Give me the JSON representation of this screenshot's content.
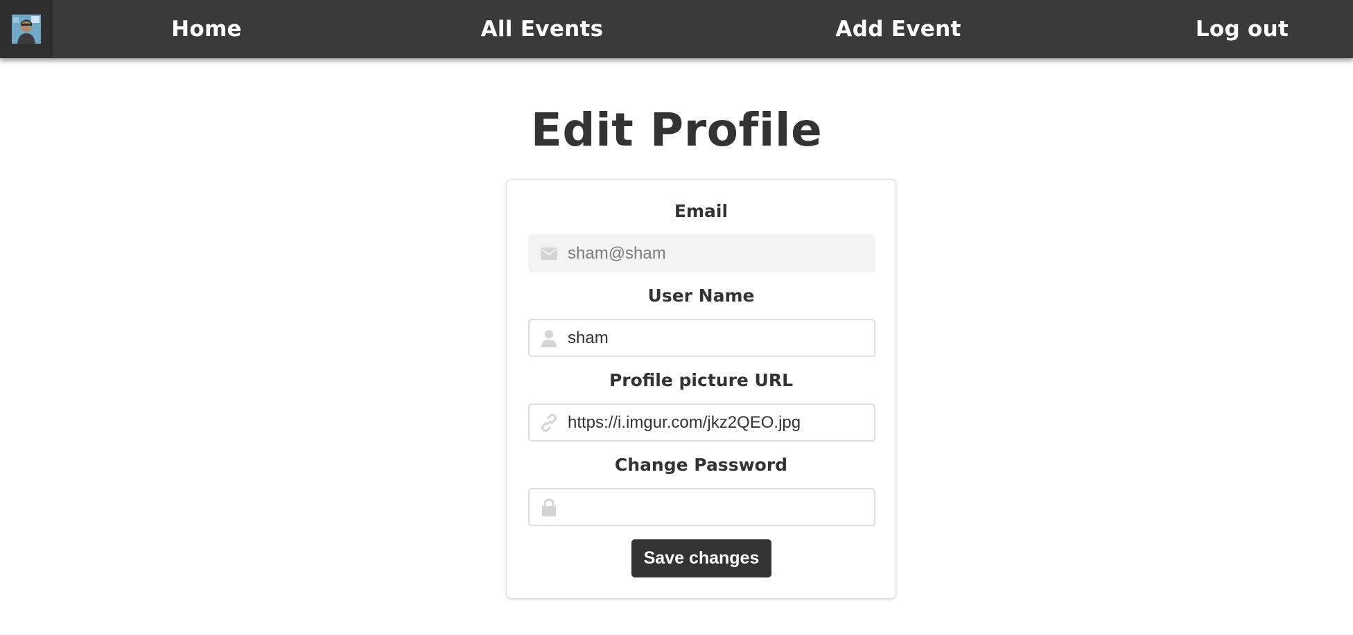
{
  "nav": {
    "avatar": "avatar-photo",
    "home": "Home",
    "all_events": "All Events",
    "add_event": "Add Event",
    "logout": "Log out"
  },
  "page": {
    "title": "Edit Profile"
  },
  "form": {
    "email": {
      "label": "Email",
      "value": "sham@sham",
      "icon": "envelope-icon",
      "disabled": true
    },
    "username": {
      "label": "User Name",
      "value": "sham",
      "icon": "user-icon"
    },
    "picture_url": {
      "label": "Profile picture URL",
      "value": "https://i.imgur.com/jkz2QEO.jpg",
      "icon": "link-icon"
    },
    "password": {
      "label": "Change Password",
      "value": "",
      "icon": "lock-icon"
    },
    "save_label": "Save changes"
  },
  "colors": {
    "navbar": "#3a3a3a",
    "text": "#333333",
    "button": "#333333",
    "icon": "#d4d4d4"
  }
}
